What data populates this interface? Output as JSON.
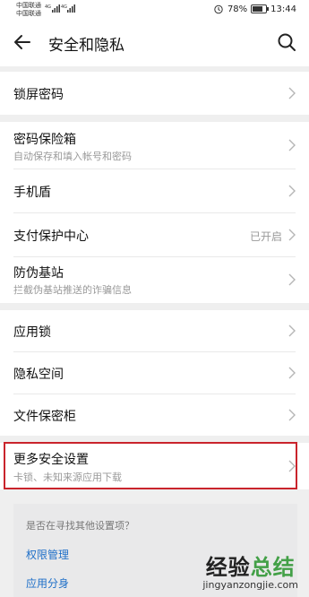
{
  "status_bar": {
    "carrier1": "中国联通",
    "carrier2": "中国联通",
    "net1": "4G",
    "net2": "4G",
    "battery": "78%",
    "time": "13:44"
  },
  "header": {
    "title": "安全和隐私"
  },
  "sections": [
    {
      "items": [
        {
          "label": "锁屏密码"
        }
      ]
    },
    {
      "items": [
        {
          "label": "密码保险箱",
          "sub": "自动保存和填入帐号和密码"
        },
        {
          "label": "手机盾"
        },
        {
          "label": "支付保护中心",
          "value": "已开启"
        },
        {
          "label": "防伪基站",
          "sub": "拦截伪基站推送的诈骗信息"
        }
      ]
    },
    {
      "items": [
        {
          "label": "应用锁"
        },
        {
          "label": "隐私空间"
        },
        {
          "label": "文件保密柜"
        }
      ]
    },
    {
      "items": [
        {
          "label": "更多安全设置",
          "sub": "卡锁、未知来源应用下载"
        }
      ]
    }
  ],
  "suggest": {
    "question": "是否在寻找其他设置项？",
    "links": [
      "权限管理",
      "应用分身"
    ]
  },
  "watermark": {
    "line1a": "经验",
    "line1b": "总结",
    "line2": "jingyanzongjie.com"
  },
  "colors": {
    "highlight": "#c9242c",
    "link": "#1e6fc8",
    "background": "#efefef"
  }
}
